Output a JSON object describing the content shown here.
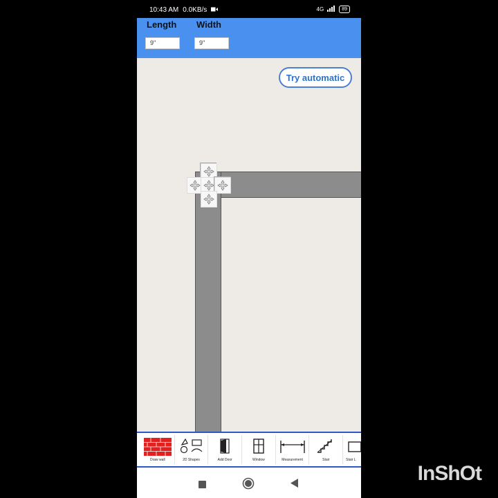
{
  "status_bar": {
    "time": "10:43 AM",
    "speed": "0.0KB/s",
    "network": "4G",
    "battery": "89"
  },
  "header": {
    "length_label": "Length",
    "width_label": "Width",
    "length_value": "9\"",
    "width_value": "9\""
  },
  "canvas": {
    "try_automatic_label": "Try automatic"
  },
  "toolbar": {
    "items": [
      {
        "label": "Draw wall"
      },
      {
        "label": "2D Shapes"
      },
      {
        "label": "Add Door"
      },
      {
        "label": "Window"
      },
      {
        "label": "Measurement"
      },
      {
        "label": "Stair"
      },
      {
        "label": "Stair L"
      }
    ]
  },
  "watermark": "InShOt",
  "colors": {
    "header": "#4a90ef",
    "canvas": "#eeebe6",
    "wall": "#8c8c8c",
    "toolbar_border": "#2e57c6",
    "accent_text": "#2f72c9"
  }
}
